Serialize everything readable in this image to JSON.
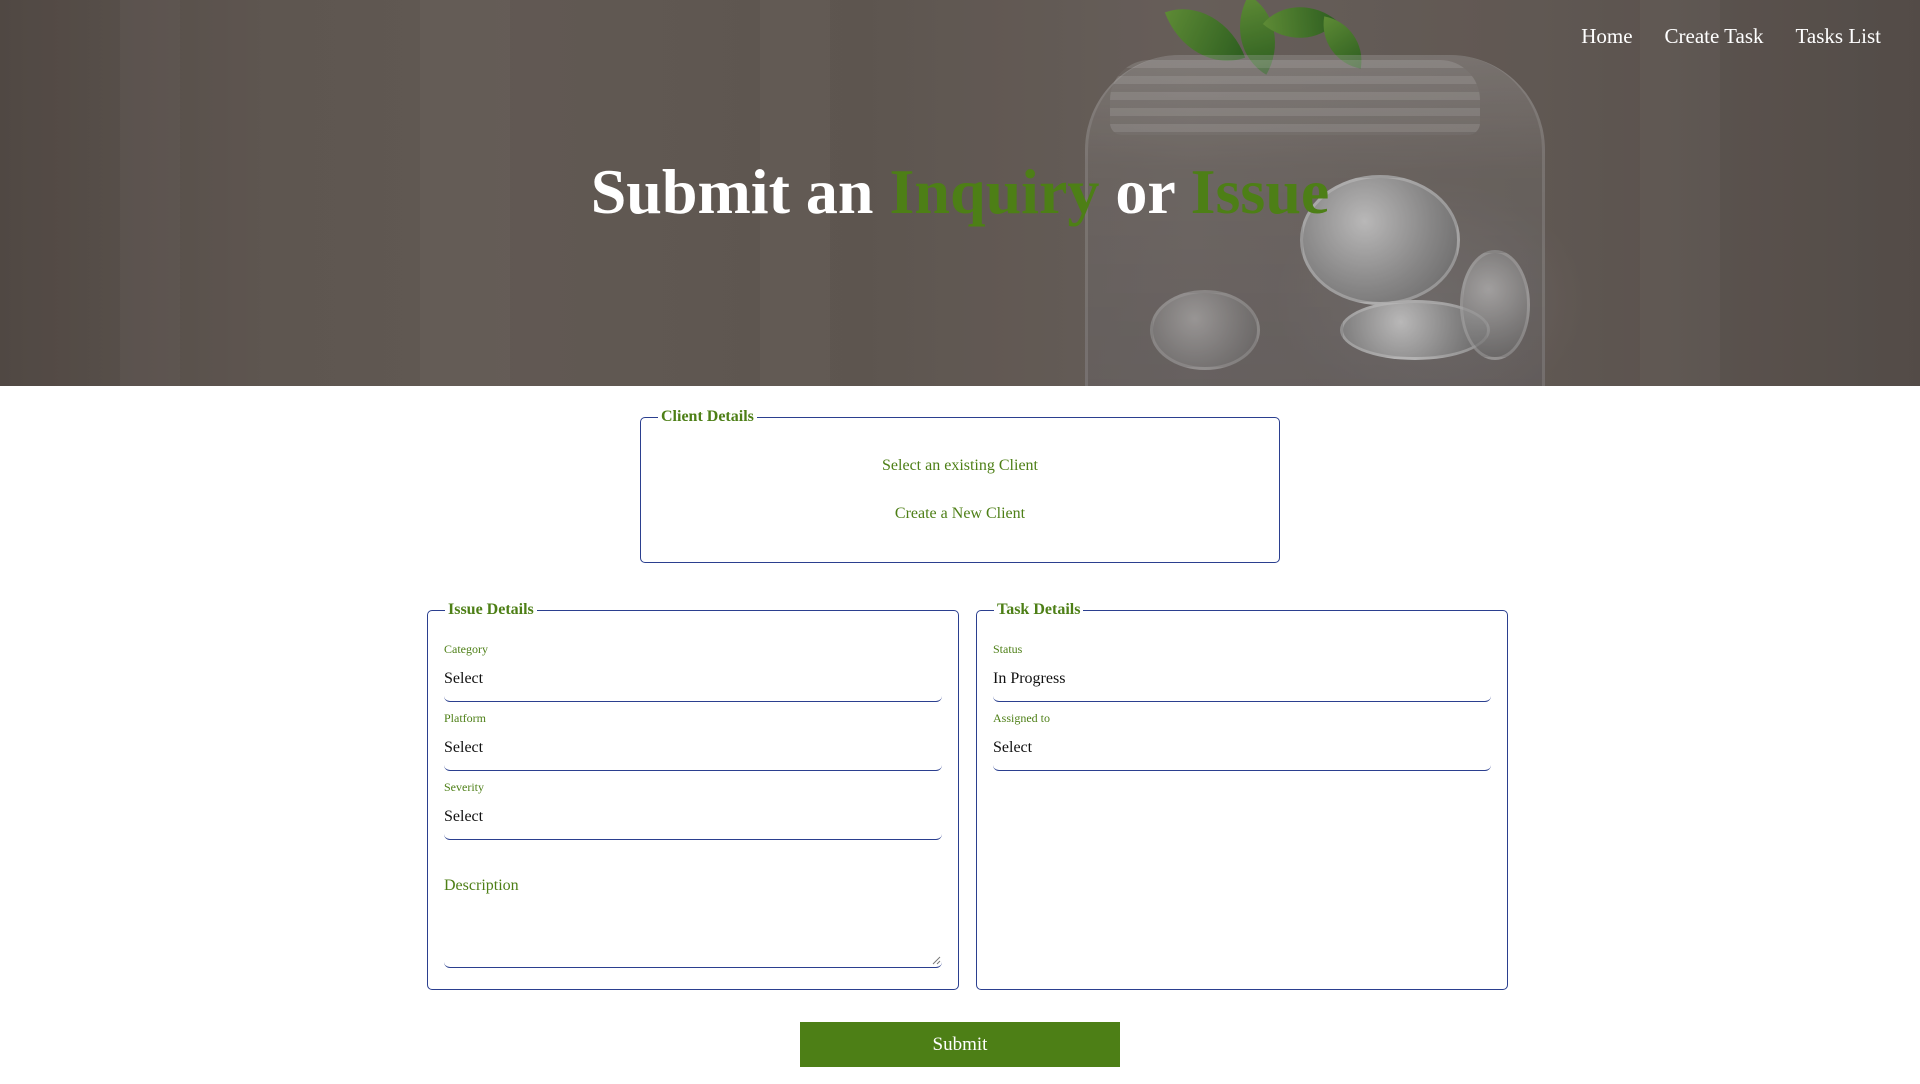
{
  "nav": {
    "items": [
      {
        "label": "Home"
      },
      {
        "label": "Create Task"
      },
      {
        "label": "Tasks List"
      }
    ]
  },
  "hero": {
    "title_part1": "Submit an ",
    "title_accent1": "Inquiry",
    "title_part2": " or ",
    "title_accent2": "Issue"
  },
  "client_details": {
    "legend": "Client Details",
    "option_existing": "Select an existing Client",
    "option_new": "Create a New Client"
  },
  "issue_details": {
    "legend": "Issue Details",
    "category": {
      "label": "Category",
      "value": "Select"
    },
    "platform": {
      "label": "Platform",
      "value": "Select"
    },
    "severity": {
      "label": "Severity",
      "value": "Select"
    },
    "description_placeholder": "Description"
  },
  "task_details": {
    "legend": "Task Details",
    "status": {
      "label": "Status",
      "value": "In Progress"
    },
    "assigned_to": {
      "label": "Assigned to",
      "value": "Select"
    }
  },
  "submit_label": "Submit",
  "colors": {
    "accent_green": "#4d7f16",
    "border_blue": "#2b3f8f"
  },
  "icons": {
    "resize_handle": "resize-handle-icon"
  }
}
